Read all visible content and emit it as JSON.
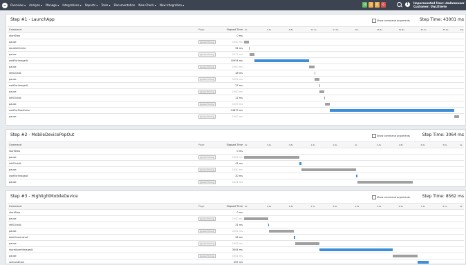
{
  "navbar": {
    "items": [
      "Overview ▾",
      "Analyze ▾",
      "Manage ▾",
      "Integrations ▾",
      "Reports ▾",
      "Tools ▾",
      "Documentation",
      "New Check ▾",
      "New Integration ▾"
    ],
    "badges": [
      {
        "label": "16",
        "color": "#5cb85c"
      },
      {
        "label": "3",
        "color": "#f0ad4e"
      },
      {
        "label": "0",
        "color": "#f0ad4e"
      },
      {
        "label": "6",
        "color": "#d9534f"
      }
    ],
    "user_line1": "Impersonated User: dadamsuser",
    "user_line2": "Customer: UwLitterie"
  },
  "headers": {
    "command": "Command",
    "page": "Page",
    "elapsed": "Elapsed Time"
  },
  "ignore_label": "Ignore Timing",
  "show_args_label": "Show command arguments",
  "steps": [
    {
      "title": "Step #1 - LaunchApp",
      "step_time": "Step Time: 43001 ms",
      "ticks": [
        "0s",
        "4.4s",
        "8.8s",
        "13.2s",
        "17.6s",
        "22s",
        "26.4s",
        "30.8s",
        "35.2s",
        "39.6s",
        "44s"
      ],
      "rows": [
        {
          "cmd": "startStep",
          "ignore": false,
          "elapsed": "0 ms",
          "start": 0,
          "dur": 0,
          "color": "gray"
        },
        {
          "cmd": "pause",
          "ignore": true,
          "elapsed": "1000 ms",
          "start": 0,
          "dur": 1000,
          "color": "gray"
        },
        {
          "cmd": "doubleClickAt",
          "ignore": false,
          "elapsed": "94 ms",
          "start": 1000,
          "dur": 94,
          "color": "gray"
        },
        {
          "cmd": "pause",
          "ignore": true,
          "elapsed": "1017 ms",
          "start": 1094,
          "dur": 1017,
          "color": "gray"
        },
        {
          "cmd": "waitForImageAt",
          "ignore": false,
          "elapsed": "10954 ms",
          "start": 2111,
          "dur": 10954,
          "color": "blue"
        },
        {
          "cmd": "pause",
          "ignore": true,
          "elapsed": "1000 ms",
          "start": 13065,
          "dur": 1000,
          "color": "gray"
        },
        {
          "cmd": "leftClickAt",
          "ignore": false,
          "elapsed": "18 ms",
          "start": 14065,
          "dur": 18,
          "color": "gray"
        },
        {
          "cmd": "pause",
          "ignore": true,
          "elapsed": "1001 ms",
          "start": 14083,
          "dur": 1001,
          "color": "gray"
        },
        {
          "cmd": "waitForImageAt",
          "ignore": false,
          "elapsed": "27 ms",
          "start": 15084,
          "dur": 27,
          "color": "gray"
        },
        {
          "cmd": "pause",
          "ignore": true,
          "elapsed": "1000 ms",
          "start": 15111,
          "dur": 1000,
          "color": "gray"
        },
        {
          "cmd": "leftClickAt",
          "ignore": false,
          "elapsed": "12 ms",
          "start": 16111,
          "dur": 12,
          "color": "gray"
        },
        {
          "cmd": "pause",
          "ignore": true,
          "elapsed": "1003 ms",
          "start": 16123,
          "dur": 1003,
          "color": "gray"
        },
        {
          "cmd": "waitForPixelColor",
          "ignore": false,
          "elapsed": "24879 ms",
          "start": 17126,
          "dur": 24879,
          "color": "blue"
        },
        {
          "cmd": "pause",
          "ignore": true,
          "elapsed": "1000 ms",
          "start": 42005,
          "dur": 1000,
          "color": "gray"
        }
      ]
    },
    {
      "title": "Step #2 - MobileDevicePopOut",
      "step_time": "Step Time: 3064 ms",
      "ticks": [
        "0s",
        "0.4s",
        "0.8s",
        "1.2s",
        "1.6s",
        "2s",
        "2.4s",
        "2.8s",
        "3.2s",
        "3.6s",
        "4s"
      ],
      "rows": [
        {
          "cmd": "startStep",
          "ignore": false,
          "elapsed": "0 ms",
          "start": 0,
          "dur": 0,
          "color": "gray"
        },
        {
          "cmd": "pause",
          "ignore": true,
          "elapsed": "1001 ms",
          "start": 0,
          "dur": 1001,
          "color": "gray"
        },
        {
          "cmd": "leftClickAt",
          "ignore": false,
          "elapsed": "41 ms",
          "start": 1001,
          "dur": 41,
          "color": "blue"
        },
        {
          "cmd": "pause",
          "ignore": true,
          "elapsed": "1000 ms",
          "start": 1042,
          "dur": 1000,
          "color": "gray"
        },
        {
          "cmd": "waitForImageAt",
          "ignore": false,
          "elapsed": "20 ms",
          "start": 2042,
          "dur": 20,
          "color": "blue"
        },
        {
          "cmd": "pause",
          "ignore": true,
          "elapsed": "1002 ms",
          "start": 2062,
          "dur": 1002,
          "color": "gray"
        }
      ]
    },
    {
      "title": "Step #3 - HighlightMobileDevice",
      "step_time": "Step Time: 8562 ms",
      "ticks": [
        "0s",
        "0.9s",
        "1.8s",
        "2.7s",
        "3.6s",
        "4.5s",
        "5.4s",
        "6.3s",
        "7.2s",
        "8.1s",
        "9s"
      ],
      "rows": [
        {
          "cmd": "startStep",
          "ignore": false,
          "elapsed": "0 ms",
          "start": 0,
          "dur": 0,
          "color": "gray"
        },
        {
          "cmd": "pause",
          "ignore": true,
          "elapsed": "1000 ms",
          "start": 0,
          "dur": 1000,
          "color": "gray"
        },
        {
          "cmd": "leftClickAt",
          "ignore": false,
          "elapsed": "31 ms",
          "start": 1000,
          "dur": 31,
          "color": "blue"
        },
        {
          "cmd": "pause",
          "ignore": true,
          "elapsed": "1001 ms",
          "start": 1031,
          "dur": 1001,
          "color": "gray"
        },
        {
          "cmd": "takeScreenshot",
          "ignore": false,
          "elapsed": "56 ms",
          "start": 2032,
          "dur": 56,
          "color": "blue"
        },
        {
          "cmd": "pause",
          "ignore": true,
          "elapsed": "1003 ms",
          "start": 2088,
          "dur": 1003,
          "color": "gray"
        },
        {
          "cmd": "storeAssertImageAt",
          "ignore": false,
          "elapsed": "3004 ms",
          "start": 3091,
          "dur": 3004,
          "color": "blue"
        },
        {
          "cmd": "pause",
          "ignore": true,
          "elapsed": "1001 ms",
          "start": 6095,
          "dur": 1001,
          "color": "gray"
        },
        {
          "cmd": "setCondition",
          "ignore": false,
          "elapsed": "467 ms",
          "start": 7096,
          "dur": 467,
          "color": "blue"
        }
      ]
    }
  ]
}
